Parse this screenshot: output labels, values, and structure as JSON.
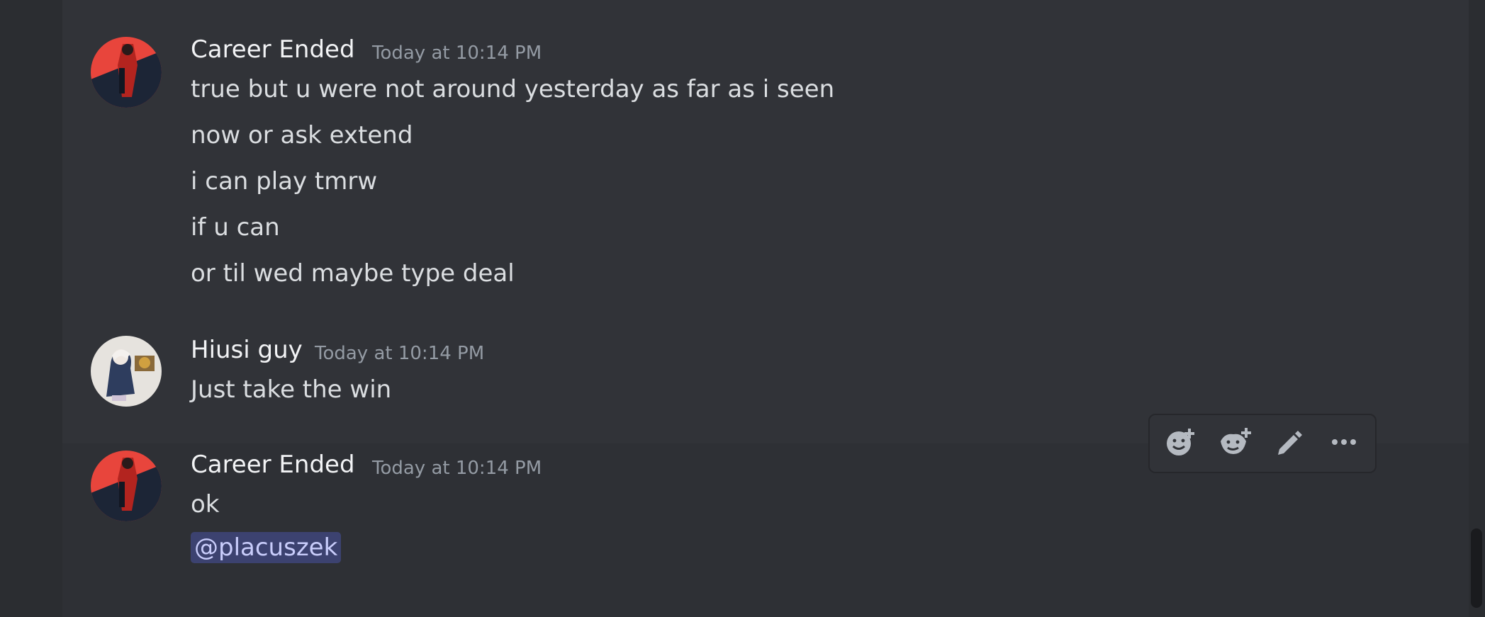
{
  "messages": [
    {
      "author": "Career Ended",
      "timestamp": "Today at 10:14 PM",
      "avatar": "red-dark-character-avatar",
      "lines": [
        "true but u were not around yesterday as far as i seen",
        "now or ask extend",
        "i can play tmrw",
        "if u can",
        "or til wed maybe type deal"
      ]
    },
    {
      "author": "Hiusi guy",
      "timestamp": "Today at 10:14 PM",
      "avatar": "anime-character-avatar",
      "lines": [
        "Just take the win"
      ]
    },
    {
      "author": "Career Ended",
      "timestamp": "Today at 10:14 PM",
      "avatar": "red-dark-character-avatar",
      "lines": [
        "ok"
      ],
      "mention": "@placuszek"
    }
  ],
  "toolbar": {
    "icons": [
      "add-reaction-icon",
      "add-super-reaction-icon",
      "edit-pencil-icon",
      "more-options-icon"
    ]
  },
  "colors": {
    "background": "#313338",
    "mention_bg": "#3c4270",
    "mention_text": "#c9cdfb",
    "timestamp": "#949ba4"
  }
}
